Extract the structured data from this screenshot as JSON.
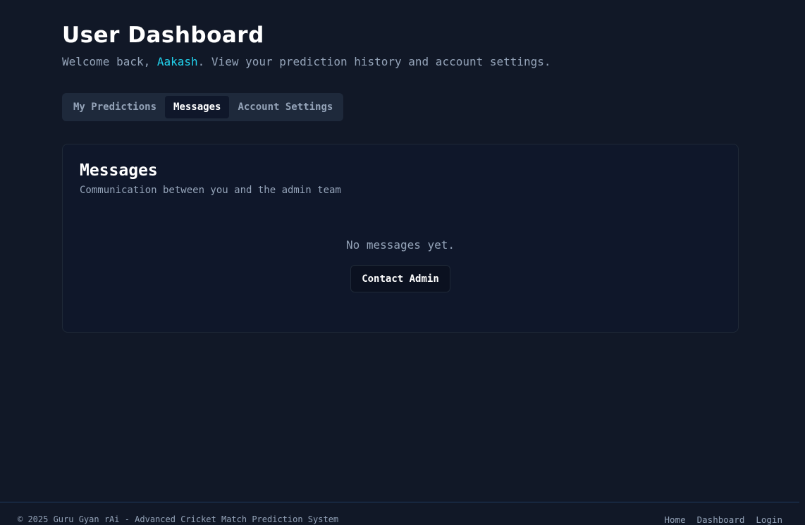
{
  "header": {
    "title": "User Dashboard",
    "welcome_prefix": "Welcome back, ",
    "username": "Aakash",
    "welcome_suffix": ". View your prediction history and account settings."
  },
  "tabs": [
    {
      "label": "My Predictions",
      "active": false
    },
    {
      "label": "Messages",
      "active": true
    },
    {
      "label": "Account Settings",
      "active": false
    }
  ],
  "messages_card": {
    "title": "Messages",
    "subtitle": "Communication between you and the admin team",
    "empty_text": "No messages yet.",
    "contact_button": "Contact Admin"
  },
  "footer": {
    "copyright": "© 2025 Guru Gyan rAi - Advanced Cricket Match Prediction System",
    "links": [
      "Home",
      "Dashboard",
      "Login"
    ]
  },
  "colors": {
    "background": "#111827",
    "accent": "#22d3ee",
    "muted_text": "#94a3b8"
  }
}
